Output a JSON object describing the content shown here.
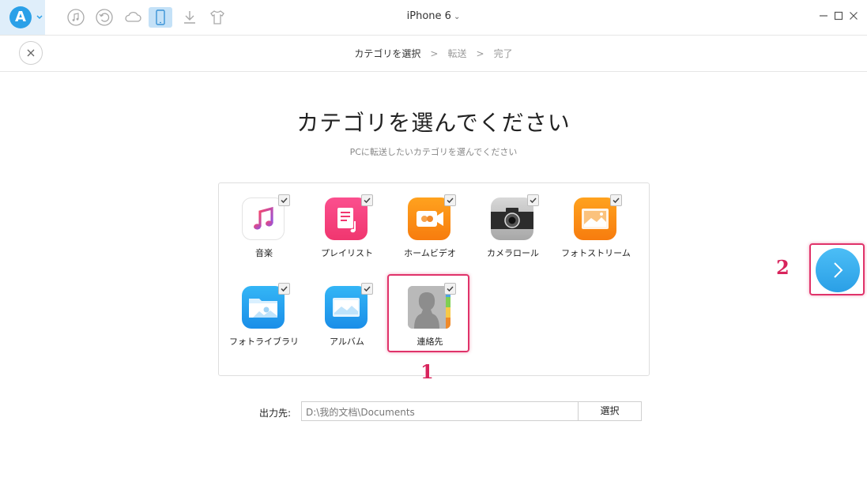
{
  "window": {
    "title": "iPhone 6",
    "title_caret": "⌄"
  },
  "toolbar": {
    "logo_letter": "A",
    "icons": [
      "music-icon",
      "restore-icon",
      "cloud-icon",
      "phone-icon",
      "download-icon",
      "tshirt-icon"
    ],
    "active_icon": "phone-icon"
  },
  "steps": {
    "current": "カテゴリを選択",
    "separator": ">",
    "second": "転送",
    "third": "完了"
  },
  "main": {
    "heading": "カテゴリを選んでください",
    "subheading": "PCに転送したいカテゴリを選んでください"
  },
  "categories": [
    {
      "label": "音楽",
      "icon": "music-app-icon",
      "checked": true
    },
    {
      "label": "プレイリスト",
      "icon": "playlist-icon",
      "checked": true
    },
    {
      "label": "ホームビデオ",
      "icon": "home-video-icon",
      "checked": true
    },
    {
      "label": "カメラロール",
      "icon": "camera-icon",
      "checked": true
    },
    {
      "label": "フォトストリーム",
      "icon": "photo-stream-icon",
      "checked": true
    },
    {
      "label": "フォトライブラリ",
      "icon": "photo-library-icon",
      "checked": true
    },
    {
      "label": "アルバム",
      "icon": "album-icon",
      "checked": true
    },
    {
      "label": "連絡先",
      "icon": "contacts-icon",
      "checked": true
    }
  ],
  "annotations": {
    "one": "1",
    "two": "2"
  },
  "output": {
    "label": "出力先:",
    "path": "D:\\我的文档\\Documents",
    "button": "選択"
  },
  "colors": {
    "accent": "#2aa0e8",
    "highlight": "#e0336a"
  }
}
